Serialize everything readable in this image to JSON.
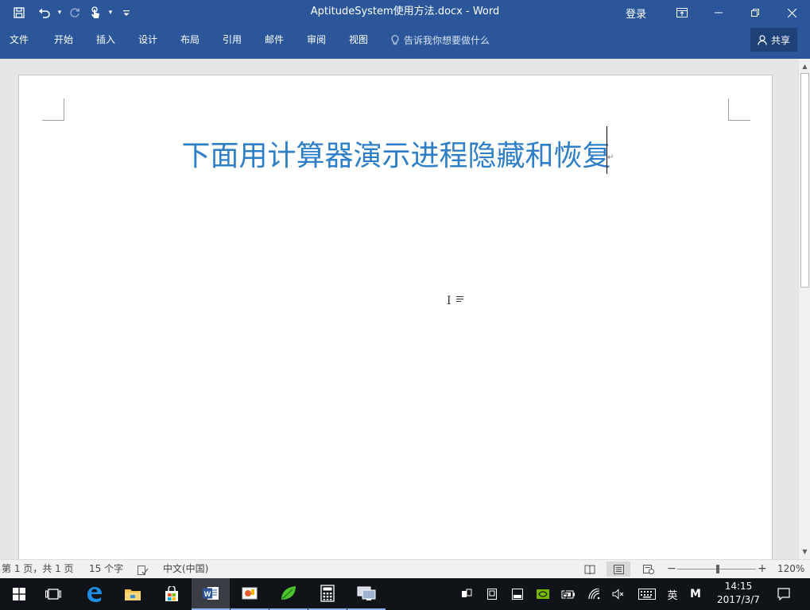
{
  "window": {
    "title": "AptitudeSystem使用方法.docx  -  Word",
    "signin": "登录",
    "icons": [
      "ribbon-display-icon",
      "minimize-icon",
      "restore-icon",
      "close-icon"
    ]
  },
  "qat": {
    "icons": [
      "save-icon",
      "undo-icon",
      "redo-icon",
      "touch-mode-icon",
      "customize-qat-icon"
    ]
  },
  "ribbon": {
    "tabs": [
      "文件",
      "开始",
      "插入",
      "设计",
      "布局",
      "引用",
      "邮件",
      "审阅",
      "视图"
    ],
    "tell_me": "告诉我你想要做什么",
    "share": "共享"
  },
  "document": {
    "heading": "下面用计算器演示进程隐藏和恢复",
    "heading_color": "#2e7fc8",
    "paragraph_mark": "↵"
  },
  "status": {
    "page": "第 1 页，共 1 页",
    "words": "15 个字",
    "language": "中文(中国)",
    "zoom_minus": "−",
    "zoom_plus": "+",
    "zoom": "120%"
  },
  "taskbar": {
    "apps": [
      "start-icon",
      "task-view-icon",
      "edge-icon",
      "file-explorer-icon",
      "store-icon",
      "word-icon",
      "paint-icon",
      "leaf-app-icon",
      "calculator-icon",
      "remote-desktop-icon"
    ],
    "ime_lang": "英",
    "ime_mode": "M",
    "time": "14:15",
    "date": "2017/3/7"
  },
  "colors": {
    "accent": "#2b579a",
    "taskbar": "#101419"
  }
}
